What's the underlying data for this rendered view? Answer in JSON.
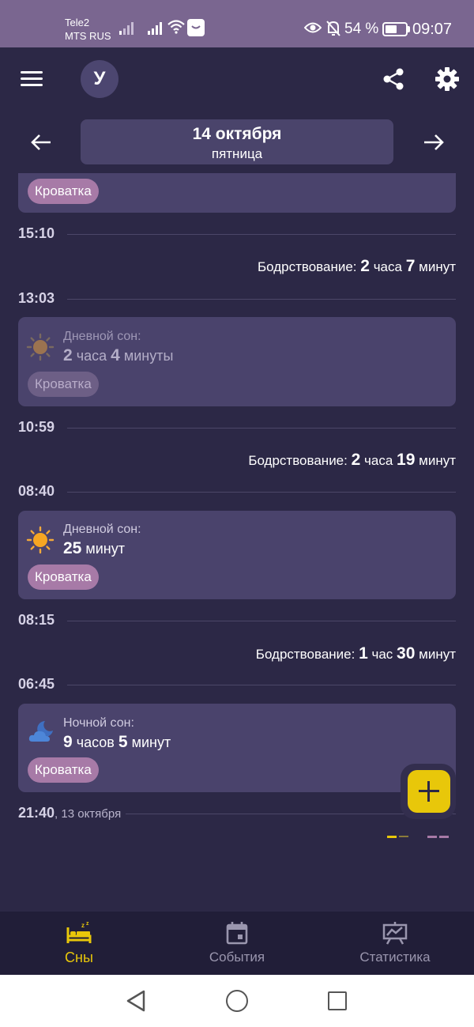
{
  "status_bar": {
    "carrier1": "Tele2",
    "carrier2": "MTS RUS",
    "battery_percent": "54 %",
    "battery_level": 0.54,
    "time": "09:07"
  },
  "app_bar": {
    "avatar_letter": "У",
    "icons": [
      "menu-icon",
      "share-icon",
      "gear-icon"
    ]
  },
  "date_nav": {
    "date": "14 октября",
    "weekday": "пятница"
  },
  "timeline": {
    "top_card": {
      "tag": "Кроватка"
    },
    "time_1510": "15:10",
    "awake_1": {
      "label": "Бодрствование:",
      "n1": "2",
      "u1": "часа",
      "n2": "7",
      "u2": "минут"
    },
    "time_1303": "13:03",
    "card_day1": {
      "label": "Дневной сон:",
      "n1": "2",
      "u1": "часа",
      "n2": "4",
      "u2": "минуты",
      "tag": "Кроватка",
      "icon": "sun-icon"
    },
    "time_1059": "10:59",
    "awake_2": {
      "label": "Бодрствование:",
      "n1": "2",
      "u1": "часа",
      "n2": "19",
      "u2": "минут"
    },
    "time_0840": "08:40",
    "card_day2": {
      "label": "Дневной сон:",
      "n1": "25",
      "u1": "минут",
      "tag": "Кроватка",
      "icon": "sun-icon"
    },
    "time_0815": "08:15",
    "awake_3": {
      "label": "Бодрствование:",
      "n1": "1",
      "u1": "час",
      "n2": "30",
      "u2": "минут"
    },
    "time_0645": "06:45",
    "card_night": {
      "label": "Ночной сон:",
      "n1": "9",
      "u1": "часов",
      "n2": "5",
      "u2": "минут",
      "tag": "Кроватка",
      "icon": "moon-cloud-icon"
    },
    "time_2140": "21:40",
    "time_2140_date": ", 13 октября"
  },
  "bottom_nav": {
    "items": [
      {
        "label": "Сны",
        "icon": "bed-icon",
        "active": true
      },
      {
        "label": "События",
        "icon": "calendar-icon",
        "active": false
      },
      {
        "label": "Статистика",
        "icon": "chart-board-icon",
        "active": false
      }
    ]
  },
  "colors": {
    "background": "#2c2846",
    "card": "#4a436c",
    "accent_yellow": "#e8c70a",
    "tag_pink": "#a77aa7"
  }
}
